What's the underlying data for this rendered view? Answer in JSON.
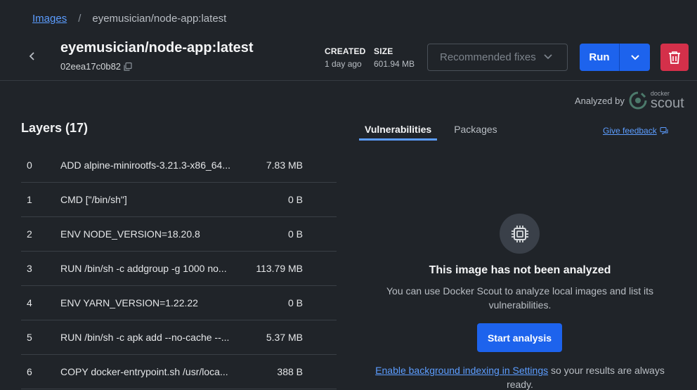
{
  "breadcrumb": {
    "link": "Images",
    "separator": "/",
    "current": "eyemusician/node-app:latest"
  },
  "header": {
    "title": "eyemusician/node-app:latest",
    "image_id": "02eea17c0b82",
    "created_label": "CREATED",
    "created_value": "1 day ago",
    "size_label": "SIZE",
    "size_value": "601.94 MB",
    "recommended_fixes": "Recommended fixes",
    "run_label": "Run"
  },
  "analyzed_by": {
    "label": "Analyzed by",
    "brand_small": "docker",
    "brand_big": "scout"
  },
  "layers": {
    "title": "Layers (17)",
    "rows": [
      {
        "idx": "0",
        "cmd": "ADD alpine-minirootfs-3.21.3-x86_64...",
        "size": "7.83 MB"
      },
      {
        "idx": "1",
        "cmd": "CMD [\"/bin/sh\"]",
        "size": "0 B"
      },
      {
        "idx": "2",
        "cmd": "ENV NODE_VERSION=18.20.8",
        "size": "0 B"
      },
      {
        "idx": "3",
        "cmd": "RUN /bin/sh -c addgroup -g 1000 no...",
        "size": "113.79 MB"
      },
      {
        "idx": "4",
        "cmd": "ENV YARN_VERSION=1.22.22",
        "size": "0 B"
      },
      {
        "idx": "5",
        "cmd": "RUN /bin/sh -c apk add --no-cache --...",
        "size": "5.37 MB"
      },
      {
        "idx": "6",
        "cmd": "COPY docker-entrypoint.sh /usr/loca...",
        "size": "388 B"
      }
    ]
  },
  "tabs": {
    "vulnerabilities": "Vulnerabilities",
    "packages": "Packages"
  },
  "feedback": "Give feedback",
  "empty_state": {
    "title": "This image has not been analyzed",
    "description": "You can use Docker Scout to analyze local images and list its vulnerabilities.",
    "button": "Start analysis",
    "link": "Enable background indexing in Settings",
    "suffix": " so your results are always ready."
  },
  "colors": {
    "accent": "#1d63ed",
    "danger": "#d4304a",
    "link": "#5c9dff",
    "background": "#202429"
  }
}
